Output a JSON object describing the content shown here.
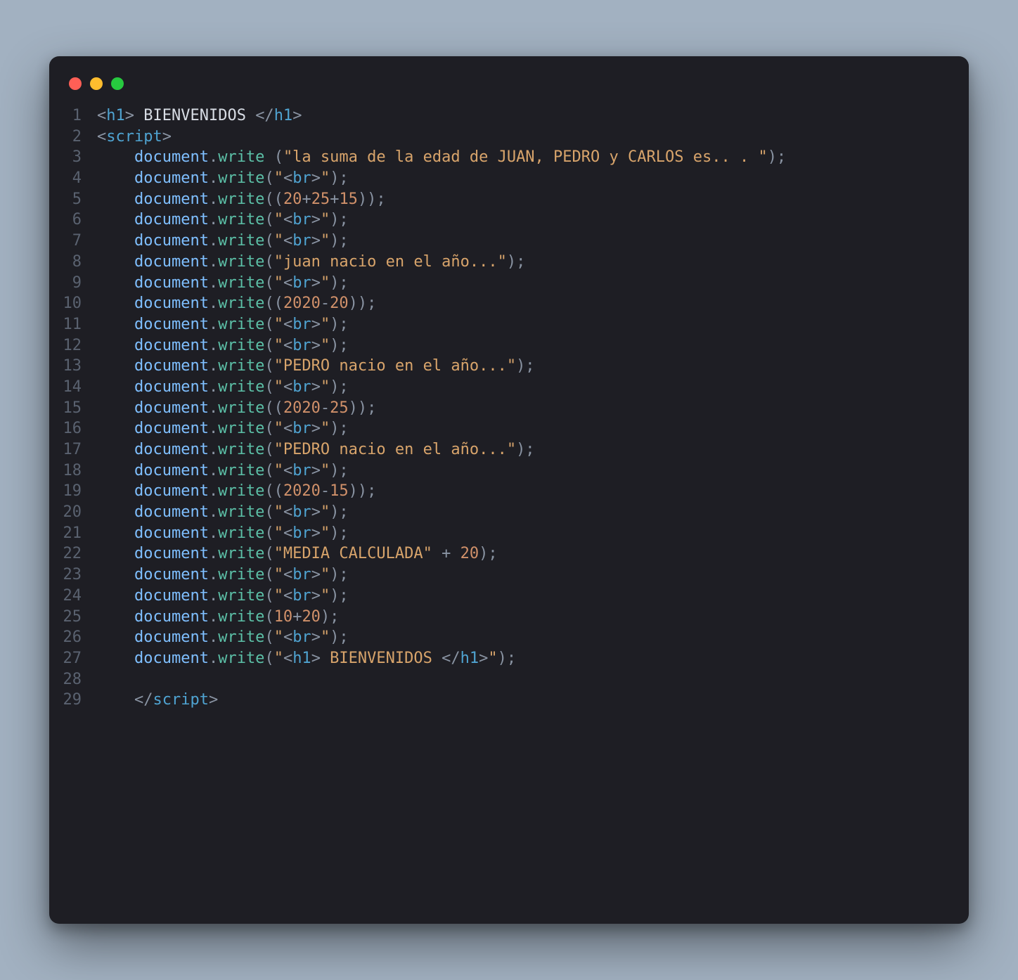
{
  "window": {
    "dots": [
      "red",
      "yellow",
      "green"
    ]
  },
  "code": {
    "indent": "    ",
    "lines": [
      {
        "n": "1",
        "tokens": [
          {
            "t": "punct",
            "v": "<"
          },
          {
            "t": "tag",
            "v": "h1"
          },
          {
            "t": "punct",
            "v": ">"
          },
          {
            "t": "plain",
            "v": " BIENVENIDOS "
          },
          {
            "t": "punct",
            "v": "</"
          },
          {
            "t": "tag",
            "v": "h1"
          },
          {
            "t": "punct",
            "v": ">"
          }
        ]
      },
      {
        "n": "2",
        "tokens": [
          {
            "t": "punct",
            "v": "<"
          },
          {
            "t": "tag",
            "v": "script"
          },
          {
            "t": "punct",
            "v": ">"
          }
        ]
      },
      {
        "n": "3",
        "indent": true,
        "tokens": [
          {
            "t": "ident",
            "v": "document"
          },
          {
            "t": "punct",
            "v": "."
          },
          {
            "t": "method",
            "v": "write"
          },
          {
            "t": "plain",
            "v": " "
          },
          {
            "t": "punct",
            "v": "("
          },
          {
            "t": "string",
            "v": "\"la suma de la edad de JUAN, PEDRO y CARLOS es.. . \""
          },
          {
            "t": "punct",
            "v": ");"
          }
        ]
      },
      {
        "n": "4",
        "indent": true,
        "tokens": [
          {
            "t": "ident",
            "v": "document"
          },
          {
            "t": "punct",
            "v": "."
          },
          {
            "t": "method",
            "v": "write"
          },
          {
            "t": "punct",
            "v": "("
          },
          {
            "t": "string",
            "v": "\"<br>\""
          },
          {
            "t": "punct",
            "v": ");"
          }
        ]
      },
      {
        "n": "5",
        "indent": true,
        "tokens": [
          {
            "t": "ident",
            "v": "document"
          },
          {
            "t": "punct",
            "v": "."
          },
          {
            "t": "method",
            "v": "write"
          },
          {
            "t": "punct",
            "v": "(("
          },
          {
            "t": "number",
            "v": "20"
          },
          {
            "t": "punct",
            "v": "+"
          },
          {
            "t": "number",
            "v": "25"
          },
          {
            "t": "punct",
            "v": "+"
          },
          {
            "t": "number",
            "v": "15"
          },
          {
            "t": "punct",
            "v": "));"
          }
        ]
      },
      {
        "n": "6",
        "indent": true,
        "tokens": [
          {
            "t": "ident",
            "v": "document"
          },
          {
            "t": "punct",
            "v": "."
          },
          {
            "t": "method",
            "v": "write"
          },
          {
            "t": "punct",
            "v": "("
          },
          {
            "t": "string",
            "v": "\"<br>\""
          },
          {
            "t": "punct",
            "v": ");"
          }
        ]
      },
      {
        "n": "7",
        "indent": true,
        "tokens": [
          {
            "t": "ident",
            "v": "document"
          },
          {
            "t": "punct",
            "v": "."
          },
          {
            "t": "method",
            "v": "write"
          },
          {
            "t": "punct",
            "v": "("
          },
          {
            "t": "string",
            "v": "\"<br>\""
          },
          {
            "t": "punct",
            "v": ");"
          }
        ]
      },
      {
        "n": "8",
        "indent": true,
        "tokens": [
          {
            "t": "ident",
            "v": "document"
          },
          {
            "t": "punct",
            "v": "."
          },
          {
            "t": "method",
            "v": "write"
          },
          {
            "t": "punct",
            "v": "("
          },
          {
            "t": "string",
            "v": "\"juan nacio en el año...\""
          },
          {
            "t": "punct",
            "v": ");"
          }
        ]
      },
      {
        "n": "9",
        "indent": true,
        "tokens": [
          {
            "t": "ident",
            "v": "document"
          },
          {
            "t": "punct",
            "v": "."
          },
          {
            "t": "method",
            "v": "write"
          },
          {
            "t": "punct",
            "v": "("
          },
          {
            "t": "string",
            "v": "\"<br>\""
          },
          {
            "t": "punct",
            "v": ");"
          }
        ]
      },
      {
        "n": "10",
        "indent": true,
        "tokens": [
          {
            "t": "ident",
            "v": "document"
          },
          {
            "t": "punct",
            "v": "."
          },
          {
            "t": "method",
            "v": "write"
          },
          {
            "t": "punct",
            "v": "(("
          },
          {
            "t": "number",
            "v": "2020"
          },
          {
            "t": "punct",
            "v": "-"
          },
          {
            "t": "number",
            "v": "20"
          },
          {
            "t": "punct",
            "v": "));"
          }
        ]
      },
      {
        "n": "11",
        "indent": true,
        "tokens": [
          {
            "t": "ident",
            "v": "document"
          },
          {
            "t": "punct",
            "v": "."
          },
          {
            "t": "method",
            "v": "write"
          },
          {
            "t": "punct",
            "v": "("
          },
          {
            "t": "string",
            "v": "\"<br>\""
          },
          {
            "t": "punct",
            "v": ");"
          }
        ]
      },
      {
        "n": "12",
        "indent": true,
        "tokens": [
          {
            "t": "ident",
            "v": "document"
          },
          {
            "t": "punct",
            "v": "."
          },
          {
            "t": "method",
            "v": "write"
          },
          {
            "t": "punct",
            "v": "("
          },
          {
            "t": "string",
            "v": "\"<br>\""
          },
          {
            "t": "punct",
            "v": ");"
          }
        ]
      },
      {
        "n": "13",
        "indent": true,
        "tokens": [
          {
            "t": "ident",
            "v": "document"
          },
          {
            "t": "punct",
            "v": "."
          },
          {
            "t": "method",
            "v": "write"
          },
          {
            "t": "punct",
            "v": "("
          },
          {
            "t": "string",
            "v": "\"PEDRO nacio en el año...\""
          },
          {
            "t": "punct",
            "v": ");"
          }
        ]
      },
      {
        "n": "14",
        "indent": true,
        "tokens": [
          {
            "t": "ident",
            "v": "document"
          },
          {
            "t": "punct",
            "v": "."
          },
          {
            "t": "method",
            "v": "write"
          },
          {
            "t": "punct",
            "v": "("
          },
          {
            "t": "string",
            "v": "\"<br>\""
          },
          {
            "t": "punct",
            "v": ");"
          }
        ]
      },
      {
        "n": "15",
        "indent": true,
        "tokens": [
          {
            "t": "ident",
            "v": "document"
          },
          {
            "t": "punct",
            "v": "."
          },
          {
            "t": "method",
            "v": "write"
          },
          {
            "t": "punct",
            "v": "(("
          },
          {
            "t": "number",
            "v": "2020"
          },
          {
            "t": "punct",
            "v": "-"
          },
          {
            "t": "number",
            "v": "25"
          },
          {
            "t": "punct",
            "v": "));"
          }
        ]
      },
      {
        "n": "16",
        "indent": true,
        "tokens": [
          {
            "t": "ident",
            "v": "document"
          },
          {
            "t": "punct",
            "v": "."
          },
          {
            "t": "method",
            "v": "write"
          },
          {
            "t": "punct",
            "v": "("
          },
          {
            "t": "string",
            "v": "\"<br>\""
          },
          {
            "t": "punct",
            "v": ");"
          }
        ]
      },
      {
        "n": "17",
        "indent": true,
        "tokens": [
          {
            "t": "ident",
            "v": "document"
          },
          {
            "t": "punct",
            "v": "."
          },
          {
            "t": "method",
            "v": "write"
          },
          {
            "t": "punct",
            "v": "("
          },
          {
            "t": "string",
            "v": "\"PEDRO nacio en el año...\""
          },
          {
            "t": "punct",
            "v": ");"
          }
        ]
      },
      {
        "n": "18",
        "indent": true,
        "tokens": [
          {
            "t": "ident",
            "v": "document"
          },
          {
            "t": "punct",
            "v": "."
          },
          {
            "t": "method",
            "v": "write"
          },
          {
            "t": "punct",
            "v": "("
          },
          {
            "t": "string",
            "v": "\"<br>\""
          },
          {
            "t": "punct",
            "v": ");"
          }
        ]
      },
      {
        "n": "19",
        "indent": true,
        "tokens": [
          {
            "t": "ident",
            "v": "document"
          },
          {
            "t": "punct",
            "v": "."
          },
          {
            "t": "method",
            "v": "write"
          },
          {
            "t": "punct",
            "v": "(("
          },
          {
            "t": "number",
            "v": "2020"
          },
          {
            "t": "punct",
            "v": "-"
          },
          {
            "t": "number",
            "v": "15"
          },
          {
            "t": "punct",
            "v": "));"
          }
        ]
      },
      {
        "n": "20",
        "indent": true,
        "tokens": [
          {
            "t": "ident",
            "v": "document"
          },
          {
            "t": "punct",
            "v": "."
          },
          {
            "t": "method",
            "v": "write"
          },
          {
            "t": "punct",
            "v": "("
          },
          {
            "t": "string",
            "v": "\"<br>\""
          },
          {
            "t": "punct",
            "v": ");"
          }
        ]
      },
      {
        "n": "21",
        "indent": true,
        "tokens": [
          {
            "t": "ident",
            "v": "document"
          },
          {
            "t": "punct",
            "v": "."
          },
          {
            "t": "method",
            "v": "write"
          },
          {
            "t": "punct",
            "v": "("
          },
          {
            "t": "string",
            "v": "\"<br>\""
          },
          {
            "t": "punct",
            "v": ");"
          }
        ]
      },
      {
        "n": "22",
        "indent": true,
        "tokens": [
          {
            "t": "ident",
            "v": "document"
          },
          {
            "t": "punct",
            "v": "."
          },
          {
            "t": "method",
            "v": "write"
          },
          {
            "t": "punct",
            "v": "("
          },
          {
            "t": "string",
            "v": "\"MEDIA CALCULADA\""
          },
          {
            "t": "punct",
            "v": " + "
          },
          {
            "t": "number",
            "v": "20"
          },
          {
            "t": "punct",
            "v": ");"
          }
        ]
      },
      {
        "n": "23",
        "indent": true,
        "tokens": [
          {
            "t": "ident",
            "v": "document"
          },
          {
            "t": "punct",
            "v": "."
          },
          {
            "t": "method",
            "v": "write"
          },
          {
            "t": "punct",
            "v": "("
          },
          {
            "t": "string",
            "v": "\"<br>\""
          },
          {
            "t": "punct",
            "v": ");"
          }
        ]
      },
      {
        "n": "24",
        "indent": true,
        "tokens": [
          {
            "t": "ident",
            "v": "document"
          },
          {
            "t": "punct",
            "v": "."
          },
          {
            "t": "method",
            "v": "write"
          },
          {
            "t": "punct",
            "v": "("
          },
          {
            "t": "string",
            "v": "\"<br>\""
          },
          {
            "t": "punct",
            "v": ");"
          }
        ]
      },
      {
        "n": "25",
        "indent": true,
        "tokens": [
          {
            "t": "ident",
            "v": "document"
          },
          {
            "t": "punct",
            "v": "."
          },
          {
            "t": "method",
            "v": "write"
          },
          {
            "t": "punct",
            "v": "("
          },
          {
            "t": "number",
            "v": "10"
          },
          {
            "t": "punct",
            "v": "+"
          },
          {
            "t": "number",
            "v": "20"
          },
          {
            "t": "punct",
            "v": ");"
          }
        ]
      },
      {
        "n": "26",
        "indent": true,
        "tokens": [
          {
            "t": "ident",
            "v": "document"
          },
          {
            "t": "punct",
            "v": "."
          },
          {
            "t": "method",
            "v": "write"
          },
          {
            "t": "punct",
            "v": "("
          },
          {
            "t": "string",
            "v": "\"<br>\""
          },
          {
            "t": "punct",
            "v": ");"
          }
        ]
      },
      {
        "n": "27",
        "indent": true,
        "tokens": [
          {
            "t": "ident",
            "v": "document"
          },
          {
            "t": "punct",
            "v": "."
          },
          {
            "t": "method",
            "v": "write"
          },
          {
            "t": "punct",
            "v": "("
          },
          {
            "t": "string",
            "v": "\"<h1> BIENVENIDOS </h1>\""
          },
          {
            "t": "punct",
            "v": ");"
          }
        ]
      },
      {
        "n": "28",
        "indent": true,
        "tokens": []
      },
      {
        "n": "29",
        "indent": true,
        "tokens": [
          {
            "t": "punct",
            "v": "</"
          },
          {
            "t": "tag",
            "v": "script"
          },
          {
            "t": "punct",
            "v": ">"
          }
        ]
      }
    ]
  }
}
